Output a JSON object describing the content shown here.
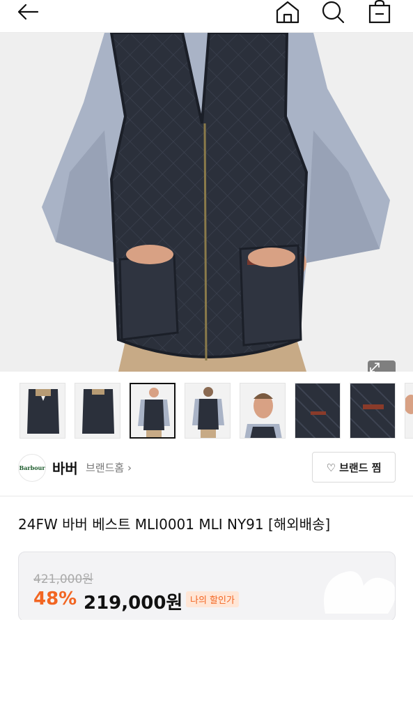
{
  "header": {
    "back_icon": "arrow-left-icon",
    "home_icon": "home-icon",
    "search_icon": "search-icon",
    "cart_icon": "shopping-bag-icon"
  },
  "hero": {
    "image_subject": "navy-quilted-vest-on-model",
    "expand_icon": "expand-icon"
  },
  "thumbnails": [
    {
      "subject": "vest-front"
    },
    {
      "subject": "vest-back"
    },
    {
      "subject": "model-front",
      "active": true
    },
    {
      "subject": "model-back"
    },
    {
      "subject": "model-closeup"
    },
    {
      "subject": "pocket-detail"
    },
    {
      "subject": "logo-detail"
    },
    {
      "subject": "partial"
    }
  ],
  "brand": {
    "logo_text": "Barbour",
    "name": "바버",
    "home_link": "브랜드홈 ›",
    "like_button": "♡ 브랜드 찜"
  },
  "product": {
    "title": "24FW 바버 베스트 MLI0001 MLI NY91 [해외배송]"
  },
  "price": {
    "original": "421,000원",
    "discount_rate": "48%",
    "sale": "219,000원",
    "my_discount_badge": "나의 할인가"
  },
  "colors": {
    "accent": "#f26522",
    "badge_bg": "#ffe6d6",
    "vest": "#2a2f3a",
    "shirt": "#a9b3c6"
  }
}
